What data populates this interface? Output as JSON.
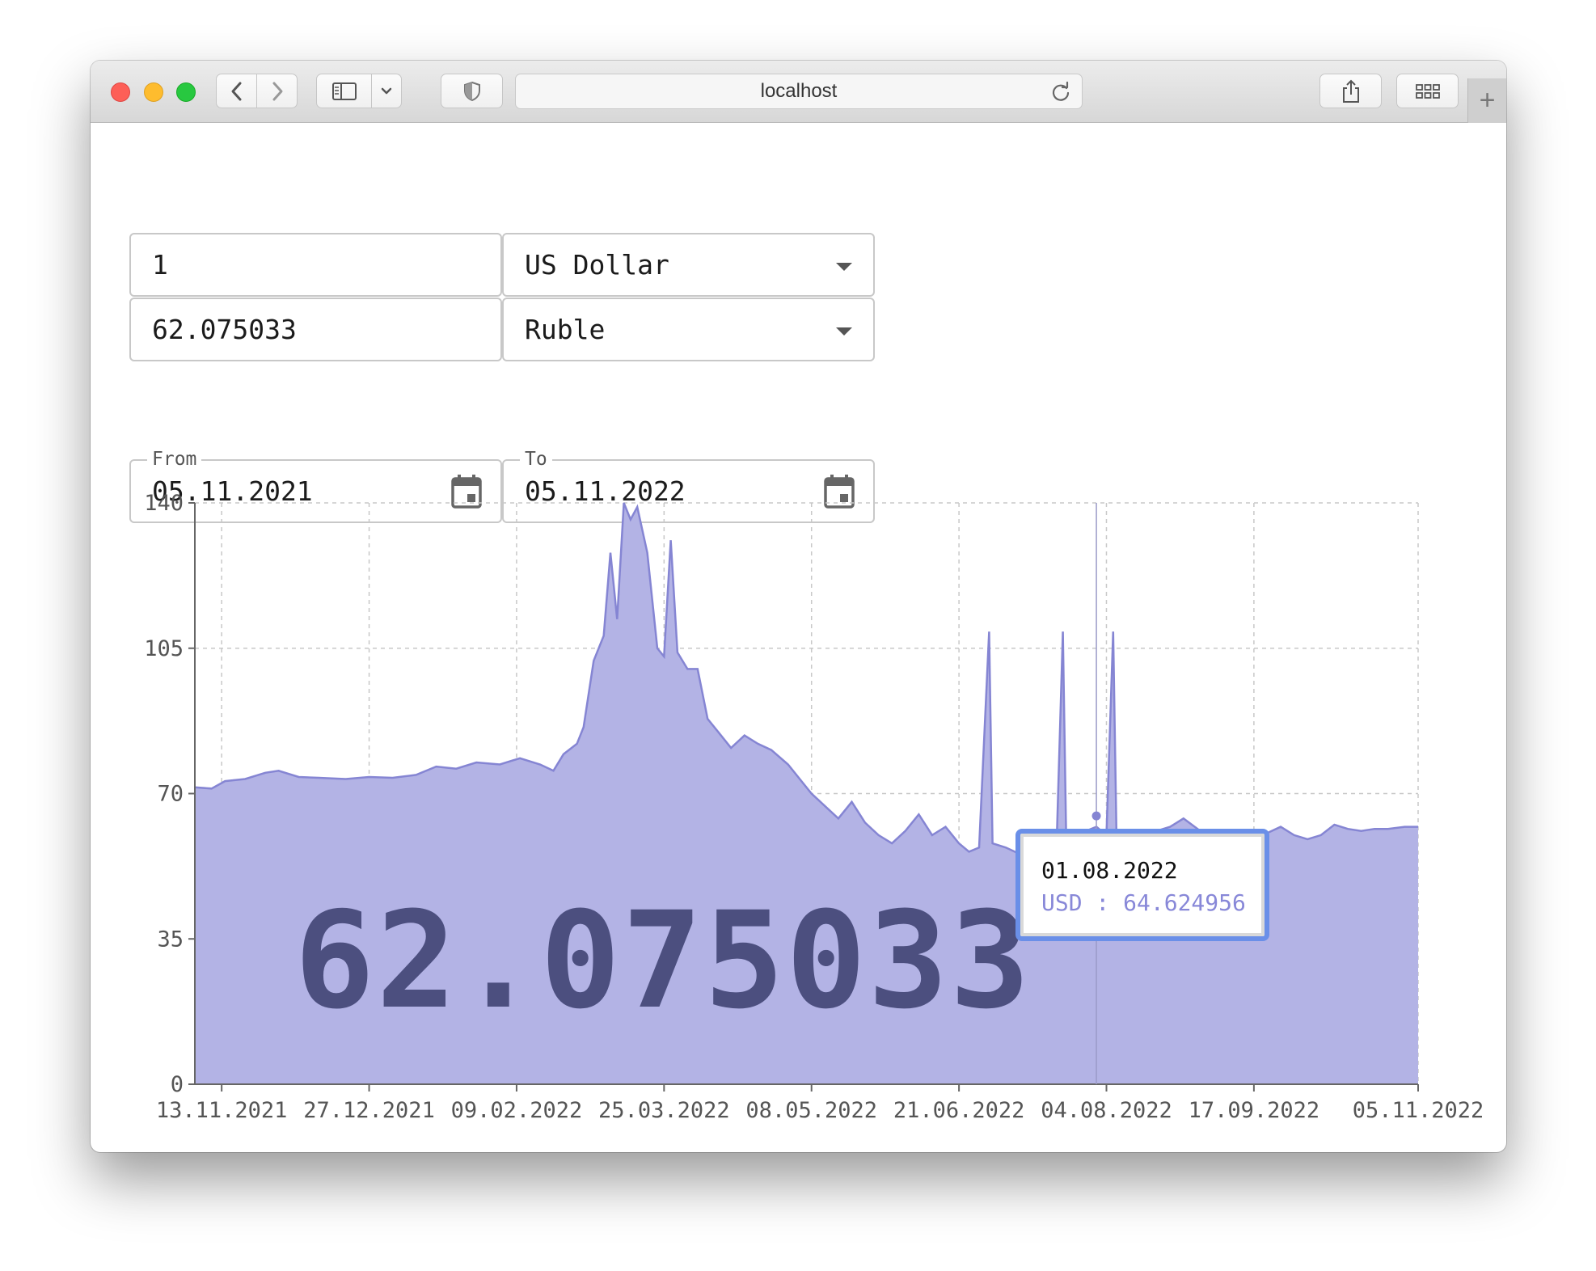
{
  "browser": {
    "url": "localhost"
  },
  "converter": {
    "amount_from": "1",
    "currency_from": "US Dollar",
    "amount_to": "62.075033",
    "currency_to": "Ruble"
  },
  "date_range": {
    "from_label": "From",
    "from_value": "05.11.2021",
    "to_label": "To",
    "to_value": "05.11.2022"
  },
  "result_overlay": "62.075033",
  "tooltip": {
    "date": "01.08.2022",
    "value": "USD : 64.624956"
  },
  "colors": {
    "area_fill": "#b3b3e5",
    "area_line": "#8585d3",
    "overlay_text": "#4c4f7f",
    "tooltip_border": "#6a8fe8"
  },
  "chart_data": {
    "type": "area",
    "ylim": [
      0,
      140
    ],
    "yticks": [
      "0",
      "35",
      "70",
      "105",
      "140"
    ],
    "xlim": [
      "05.11.2021",
      "05.11.2022"
    ],
    "xticks": [
      "13.11.2021",
      "27.12.2021",
      "09.02.2022",
      "25.03.2022",
      "08.05.2022",
      "21.06.2022",
      "04.08.2022",
      "17.09.2022",
      "05.11.2022"
    ],
    "grid": true,
    "highlight": {
      "x": "01.08.2022",
      "y": 64.624956
    },
    "series": [
      {
        "points": [
          [
            "05.11.2021",
            71.5
          ],
          [
            "10.11.2021",
            71.2
          ],
          [
            "14.11.2021",
            73.0
          ],
          [
            "20.11.2021",
            73.5
          ],
          [
            "26.11.2021",
            75.0
          ],
          [
            "30.11.2021",
            75.5
          ],
          [
            "06.12.2021",
            74.0
          ],
          [
            "12.12.2021",
            73.8
          ],
          [
            "20.12.2021",
            73.5
          ],
          [
            "27.12.2021",
            74.0
          ],
          [
            "03.01.2022",
            73.8
          ],
          [
            "10.01.2022",
            74.5
          ],
          [
            "16.01.2022",
            76.5
          ],
          [
            "22.01.2022",
            76.0
          ],
          [
            "28.01.2022",
            77.5
          ],
          [
            "04.02.2022",
            77.0
          ],
          [
            "10.02.2022",
            78.5
          ],
          [
            "16.02.2022",
            77.0
          ],
          [
            "20.02.2022",
            75.5
          ],
          [
            "23.02.2022",
            79.5
          ],
          [
            "27.02.2022",
            82.0
          ],
          [
            "01.03.2022",
            86.0
          ],
          [
            "04.03.2022",
            102.0
          ],
          [
            "07.03.2022",
            108.0
          ],
          [
            "09.03.2022",
            128.0
          ],
          [
            "11.03.2022",
            112.0
          ],
          [
            "13.03.2022",
            140.0
          ],
          [
            "15.03.2022",
            136.0
          ],
          [
            "17.03.2022",
            139.0
          ],
          [
            "20.03.2022",
            128.0
          ],
          [
            "23.03.2022",
            105.0
          ],
          [
            "25.03.2022",
            103.0
          ],
          [
            "27.03.2022",
            131.0
          ],
          [
            "29.03.2022",
            104.0
          ],
          [
            "01.04.2022",
            100.0
          ],
          [
            "04.04.2022",
            100.0
          ],
          [
            "07.04.2022",
            88.0
          ],
          [
            "10.04.2022",
            85.0
          ],
          [
            "14.04.2022",
            81.0
          ],
          [
            "18.04.2022",
            84.0
          ],
          [
            "22.04.2022",
            82.0
          ],
          [
            "26.04.2022",
            80.5
          ],
          [
            "01.05.2022",
            77.0
          ],
          [
            "05.05.2022",
            73.0
          ],
          [
            "08.05.2022",
            70.0
          ],
          [
            "12.05.2022",
            67.0
          ],
          [
            "16.05.2022",
            64.0
          ],
          [
            "20.05.2022",
            68.0
          ],
          [
            "24.05.2022",
            63.0
          ],
          [
            "28.05.2022",
            60.0
          ],
          [
            "01.06.2022",
            58.0
          ],
          [
            "05.06.2022",
            61.0
          ],
          [
            "09.06.2022",
            65.0
          ],
          [
            "13.06.2022",
            60.0
          ],
          [
            "17.06.2022",
            62.0
          ],
          [
            "21.06.2022",
            58.0
          ],
          [
            "24.06.2022",
            56.0
          ],
          [
            "27.06.2022",
            57.0
          ],
          [
            "30.06.2022",
            109.0
          ],
          [
            "01.07.2022",
            58.0
          ],
          [
            "05.07.2022",
            57.0
          ],
          [
            "09.07.2022",
            55.5
          ],
          [
            "13.07.2022",
            56.0
          ],
          [
            "17.07.2022",
            55.0
          ],
          [
            "20.07.2022",
            54.0
          ],
          [
            "22.07.2022",
            109.0
          ],
          [
            "23.07.2022",
            58.0
          ],
          [
            "26.07.2022",
            60.0
          ],
          [
            "29.07.2022",
            61.0
          ],
          [
            "01.08.2022",
            62.0
          ],
          [
            "04.08.2022",
            60.0
          ],
          [
            "06.08.2022",
            109.0
          ],
          [
            "07.08.2022",
            60.0
          ],
          [
            "11.08.2022",
            60.5
          ],
          [
            "15.08.2022",
            61.0
          ],
          [
            "19.08.2022",
            61.0
          ],
          [
            "23.08.2022",
            62.0
          ],
          [
            "27.08.2022",
            64.0
          ],
          [
            "01.09.2022",
            61.0
          ],
          [
            "05.09.2022",
            60.5
          ],
          [
            "09.09.2022",
            60.0
          ],
          [
            "13.09.2022",
            60.0
          ],
          [
            "17.09.2022",
            59.0
          ],
          [
            "21.09.2022",
            60.5
          ],
          [
            "25.09.2022",
            62.0
          ],
          [
            "29.09.2022",
            60.0
          ],
          [
            "03.10.2022",
            59.0
          ],
          [
            "07.10.2022",
            60.0
          ],
          [
            "11.10.2022",
            62.5
          ],
          [
            "15.10.2022",
            61.5
          ],
          [
            "19.10.2022",
            61.0
          ],
          [
            "23.10.2022",
            61.5
          ],
          [
            "27.10.2022",
            61.5
          ],
          [
            "01.11.2022",
            62.0
          ],
          [
            "05.11.2022",
            62.0
          ]
        ]
      }
    ]
  }
}
